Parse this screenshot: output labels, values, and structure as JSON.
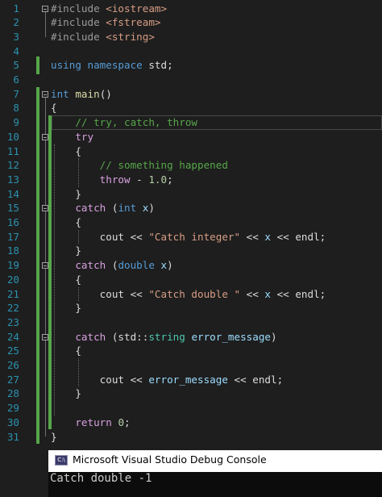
{
  "editor": {
    "line_numbers": [
      "1",
      "2",
      "3",
      "4",
      "5",
      "6",
      "7",
      "8",
      "9",
      "10",
      "11",
      "12",
      "13",
      "14",
      "15",
      "16",
      "17",
      "18",
      "19",
      "20",
      "21",
      "22",
      "23",
      "24",
      "25",
      "26",
      "27",
      "28",
      "29",
      "30",
      "31"
    ],
    "lines": [
      [
        {
          "t": "#include ",
          "c": "pp"
        },
        {
          "t": "<iostream>",
          "c": "inc"
        }
      ],
      [
        {
          "t": "#include ",
          "c": "pp"
        },
        {
          "t": "<fstream>",
          "c": "inc"
        }
      ],
      [
        {
          "t": "#include ",
          "c": "pp"
        },
        {
          "t": "<string>",
          "c": "inc"
        }
      ],
      [],
      [
        {
          "t": "using namespace ",
          "c": "kw"
        },
        {
          "t": "std;",
          "c": "txt"
        }
      ],
      [],
      [
        {
          "t": "int ",
          "c": "kw"
        },
        {
          "t": "main",
          "c": "fn"
        },
        {
          "t": "()",
          "c": "txt"
        }
      ],
      [
        {
          "t": "{",
          "c": "txt"
        }
      ],
      [
        {
          "t": "    ",
          "c": "txt"
        },
        {
          "t": "// try, catch, throw",
          "c": "com"
        }
      ],
      [
        {
          "t": "    ",
          "c": "txt"
        },
        {
          "t": "try",
          "c": "ctl"
        }
      ],
      [
        {
          "t": "    {",
          "c": "txt"
        }
      ],
      [
        {
          "t": "        ",
          "c": "txt"
        },
        {
          "t": "// something happened",
          "c": "com"
        }
      ],
      [
        {
          "t": "        ",
          "c": "txt"
        },
        {
          "t": "throw",
          "c": "ctl"
        },
        {
          "t": " - ",
          "c": "txt"
        },
        {
          "t": "1.0",
          "c": "num"
        },
        {
          "t": ";",
          "c": "txt"
        }
      ],
      [
        {
          "t": "    }",
          "c": "txt"
        }
      ],
      [
        {
          "t": "    ",
          "c": "txt"
        },
        {
          "t": "catch",
          "c": "ctl"
        },
        {
          "t": " (",
          "c": "txt"
        },
        {
          "t": "int",
          "c": "kw"
        },
        {
          "t": " ",
          "c": "txt"
        },
        {
          "t": "x",
          "c": "var"
        },
        {
          "t": ")",
          "c": "txt"
        }
      ],
      [
        {
          "t": "    {",
          "c": "txt"
        }
      ],
      [
        {
          "t": "        cout << ",
          "c": "txt"
        },
        {
          "t": "\"Catch integer\"",
          "c": "str"
        },
        {
          "t": " << ",
          "c": "txt"
        },
        {
          "t": "x",
          "c": "var"
        },
        {
          "t": " << endl;",
          "c": "txt"
        }
      ],
      [
        {
          "t": "    }",
          "c": "txt"
        }
      ],
      [
        {
          "t": "    ",
          "c": "txt"
        },
        {
          "t": "catch",
          "c": "ctl"
        },
        {
          "t": " (",
          "c": "txt"
        },
        {
          "t": "double",
          "c": "kw"
        },
        {
          "t": " ",
          "c": "txt"
        },
        {
          "t": "x",
          "c": "var"
        },
        {
          "t": ")",
          "c": "txt"
        }
      ],
      [
        {
          "t": "    {",
          "c": "txt"
        }
      ],
      [
        {
          "t": "        cout << ",
          "c": "txt"
        },
        {
          "t": "\"Catch double \"",
          "c": "str"
        },
        {
          "t": " << ",
          "c": "txt"
        },
        {
          "t": "x",
          "c": "var"
        },
        {
          "t": " << endl;",
          "c": "txt"
        }
      ],
      [
        {
          "t": "    }",
          "c": "txt"
        }
      ],
      [],
      [
        {
          "t": "    ",
          "c": "txt"
        },
        {
          "t": "catch",
          "c": "ctl"
        },
        {
          "t": " (std::",
          "c": "txt"
        },
        {
          "t": "string",
          "c": "type"
        },
        {
          "t": " ",
          "c": "txt"
        },
        {
          "t": "error_message",
          "c": "var"
        },
        {
          "t": ")",
          "c": "txt"
        }
      ],
      [
        {
          "t": "    {",
          "c": "txt"
        }
      ],
      [],
      [
        {
          "t": "        cout << ",
          "c": "txt"
        },
        {
          "t": "error_message",
          "c": "var"
        },
        {
          "t": " << endl;",
          "c": "txt"
        }
      ],
      [
        {
          "t": "    }",
          "c": "txt"
        }
      ],
      [],
      [
        {
          "t": "    ",
          "c": "txt"
        },
        {
          "t": "return",
          "c": "ctl"
        },
        {
          "t": " ",
          "c": "txt"
        },
        {
          "t": "0",
          "c": "num"
        },
        {
          "t": ";",
          "c": "txt"
        }
      ],
      [
        {
          "t": "}",
          "c": "txt"
        }
      ]
    ]
  },
  "console": {
    "title": "Microsoft Visual Studio Debug Console",
    "icon": "console-app-icon",
    "icon_text": "C:\\",
    "output": "Catch double -1"
  },
  "colors": {
    "editor_bg": "#1e1e1e",
    "line_number": "#2b91af",
    "keyword": "#569cd6",
    "control": "#d8a0df",
    "comment": "#57a64a",
    "string": "#d69d85",
    "number": "#b5cea8",
    "variable": "#9cdcfe",
    "function": "#dcdcaa",
    "type": "#4ec9b0",
    "change_bar": "#57a64a"
  }
}
